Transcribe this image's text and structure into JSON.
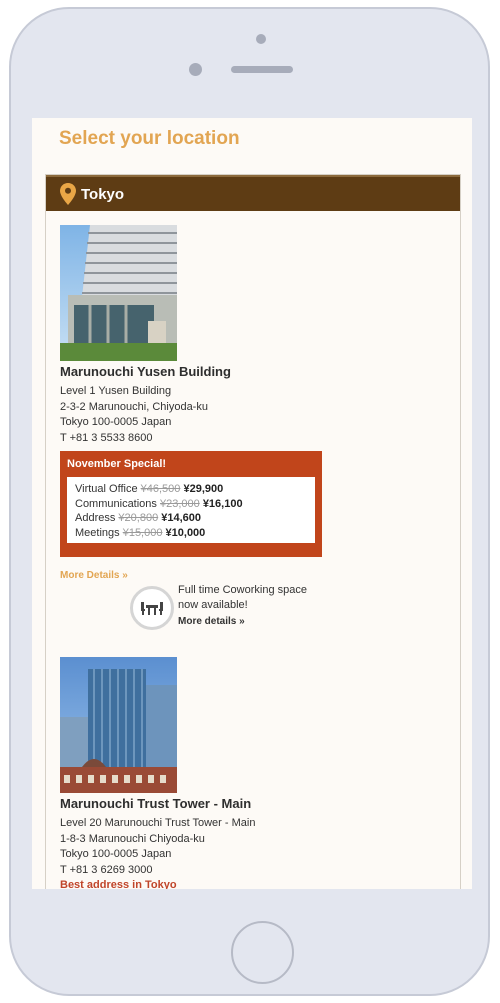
{
  "page": {
    "title": "Select your location"
  },
  "location": {
    "name": "Tokyo"
  },
  "listings": [
    {
      "name": "Marunouchi Yusen Building",
      "address": [
        "Level 1 Yusen Building",
        "2-3-2 Marunouchi, Chiyoda-ku",
        "Tokyo 100-0005 Japan",
        "T +81 3 5533 8600"
      ]
    },
    {
      "name": "Marunouchi Trust Tower - Main",
      "address": [
        "Level 20 Marunouchi Trust Tower - Main",
        "1-8-3 Marunouchi Chiyoda-ku",
        "Tokyo 100-0005 Japan",
        "T +81 3 6269 3000"
      ],
      "tagline": "Best address in Tokyo"
    }
  ],
  "special": {
    "title": "November Special!",
    "offers": [
      {
        "label": "Virtual Office",
        "old": "¥46,500",
        "new": "¥29,900"
      },
      {
        "label": "Communications",
        "old": "¥23,000",
        "new": "¥16,100"
      },
      {
        "label": "Address",
        "old": "¥20,800",
        "new": "¥14,600"
      },
      {
        "label": "Meetings",
        "old": "¥15,000",
        "new": "¥10,000"
      }
    ]
  },
  "more_details": "More Details »",
  "coworking": {
    "text_line1": "Full time Coworking space",
    "text_line2": "now available!",
    "link": "More details »"
  },
  "colors": {
    "header_brown": "#5e3c14",
    "accent_gold": "#e2a552",
    "special_orange": "#c1451b",
    "phone_frame": "#e3e6ef"
  }
}
